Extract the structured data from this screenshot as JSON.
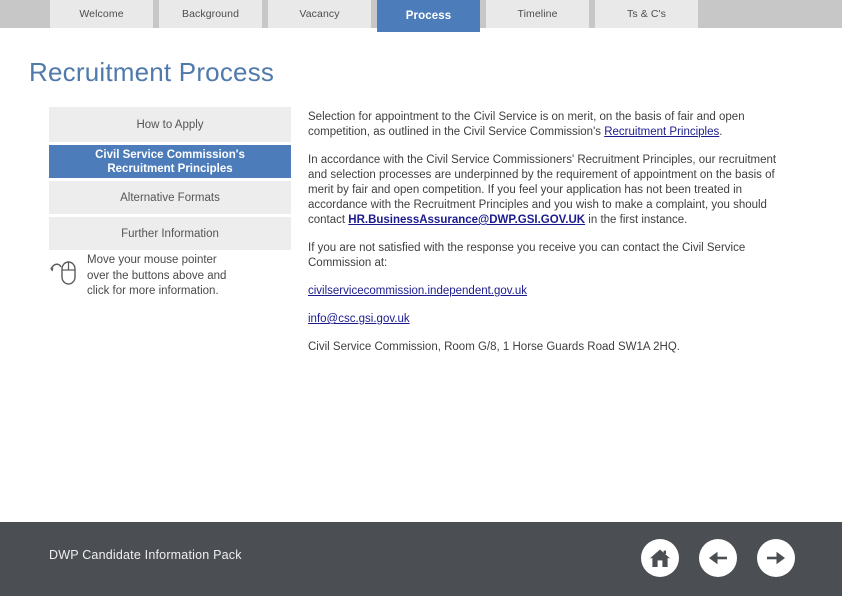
{
  "tabs": [
    {
      "label": "Welcome",
      "active": false
    },
    {
      "label": "Background",
      "active": false
    },
    {
      "label": "Vacancy",
      "active": false
    },
    {
      "label": "Process",
      "active": true
    },
    {
      "label": "Timeline",
      "active": false
    },
    {
      "label": "Ts & C's",
      "active": false
    }
  ],
  "page": {
    "title": "Recruitment Process",
    "title_color": "#4f7aab",
    "accent_color": "#4c7cb9",
    "link_color": "#1b1b8f"
  },
  "menu": {
    "items": [
      {
        "label": "How to Apply",
        "active": false
      },
      {
        "label_line1": "Civil Service Commission's",
        "label_line2": "Recruitment Principles",
        "active": true
      },
      {
        "label": "Alternative Formats",
        "active": false
      },
      {
        "label": "Further Information",
        "active": false
      }
    ],
    "hint": {
      "icon": "mouse-icon",
      "line1": "Move your mouse pointer",
      "line2": "over the buttons above and",
      "line3": "click for more information."
    }
  },
  "content": {
    "para1_before": "Selection for appointment to the Civil Service is on merit, on the basis of fair and open competition, as outlined in the Civil Service Commission's ",
    "para1_link": "Recruitment Principles",
    "para1_after": ".",
    "para2_before": "In accordance with the Civil Service Commissioners' Recruitment Principles, our recruitment and selection processes are underpinned by the requirement of appointment on the basis of merit by fair and open competition. If you feel your application has not been treated in accordance with the Recruitment Principles and you wish to make a complaint, you should contact ",
    "para2_link": "HR.BusinessAssurance@DWP.GSI.GOV.UK",
    "para2_after": " in the first instance.",
    "para3": "If you are not satisfied with the response you receive you can contact the Civil Service Commission at:",
    "link_website": "civilservicecommission.independent.gov.uk",
    "link_email": "info@csc.gsi.gov.uk",
    "para4": "Civil Service Commission, Room G/8, 1 Horse Guards Road SW1A 2HQ."
  },
  "footer": {
    "title": "DWP Candidate Information Pack",
    "background": "#4b4e53",
    "nav": [
      {
        "name": "home-icon"
      },
      {
        "name": "arrow-left-icon"
      },
      {
        "name": "arrow-right-icon"
      }
    ]
  }
}
